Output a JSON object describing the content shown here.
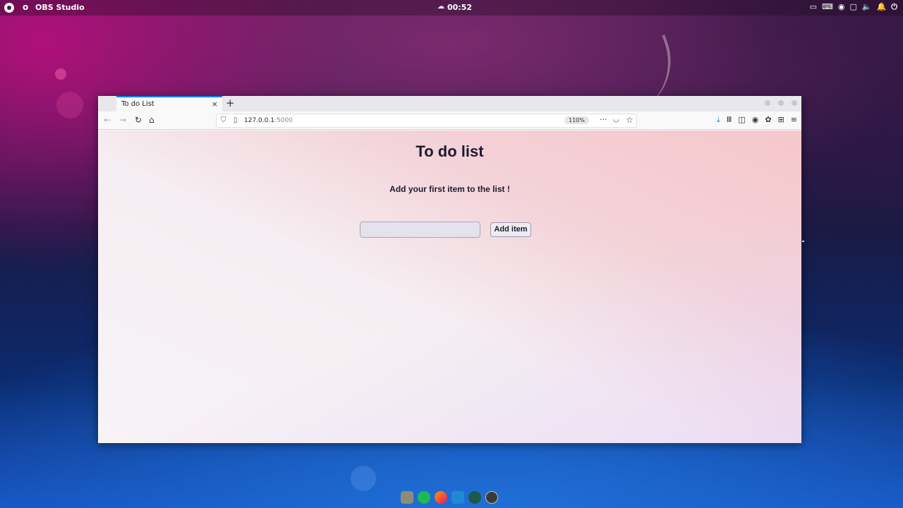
{
  "top_panel": {
    "app_name": "OBS Studio",
    "app_dot": "o",
    "clock": "00:52",
    "icons": [
      "activities-icon",
      "cloud-icon",
      "screen-icon",
      "keyboard-icon",
      "obs-tray-icon",
      "display-icon",
      "volume-icon",
      "bell-icon",
      "power-icon"
    ]
  },
  "browser": {
    "tab_title": "To do List",
    "tab_close": "×",
    "new_tab": "+",
    "url_host": "127.0.0.1",
    "url_port": ":5000",
    "zoom": "110%"
  },
  "page": {
    "title": "To do list",
    "subtitle": "Add your first item to the list !",
    "input_value": "",
    "input_placeholder": "",
    "add_button": "Add item"
  },
  "dock": {
    "apps": [
      "files-icon",
      "spotify-icon",
      "firefox-icon",
      "vscode-icon",
      "gitkraken-icon",
      "obs-icon"
    ]
  },
  "colors": {
    "accent": "#0a84ff",
    "page_text": "#1c1c2e"
  }
}
